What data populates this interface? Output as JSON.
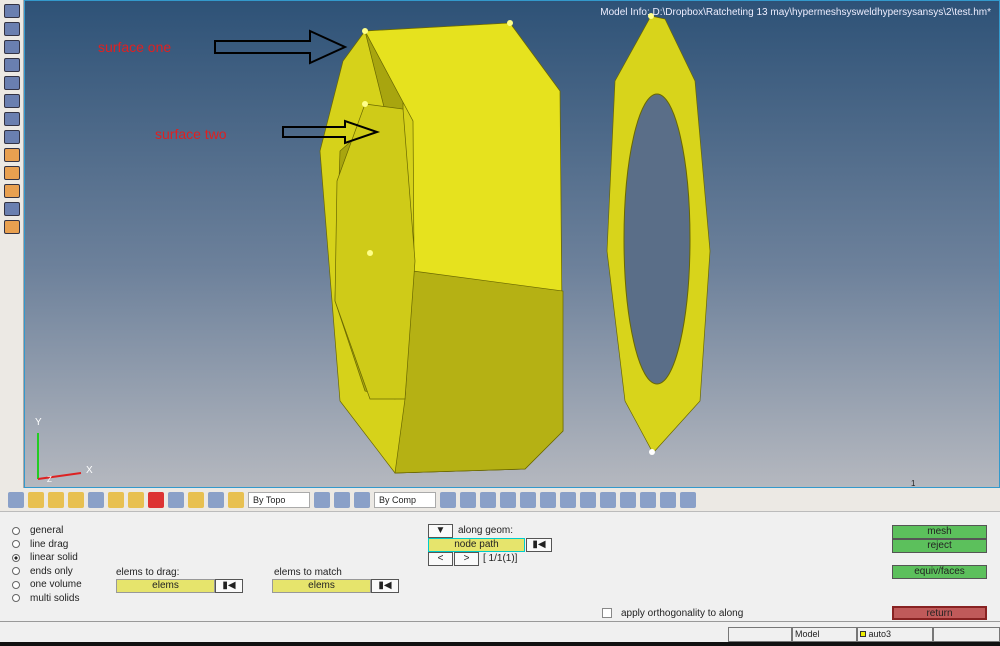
{
  "viewport": {
    "model_info": "Model Info: D:\\Dropbox\\Ratcheting 13 may\\hypermeshsysweldhypersysansys\\2\\test.hm*",
    "label_one": "surface one",
    "label_two": "surface two",
    "axis_y": "Y",
    "axis_x": "X",
    "axis_z": "Z",
    "page_num": "1"
  },
  "toolbar": {
    "by_topo": "By Topo",
    "by_comp": "By Comp"
  },
  "panel": {
    "radios": [
      {
        "label": "general",
        "checked": false
      },
      {
        "label": "line drag",
        "checked": false
      },
      {
        "label": "linear solid",
        "checked": true
      },
      {
        "label": "ends only",
        "checked": false
      },
      {
        "label": "one volume",
        "checked": false
      },
      {
        "label": "multi solids",
        "checked": false
      }
    ],
    "elems_to_drag_label": "elems to drag:",
    "elems_to_drag_btn": "elems",
    "elems_to_match_label": "elems to match",
    "elems_to_match_btn": "elems",
    "along_geom": "along geom:",
    "node_path": "node path",
    "prev": "<",
    "next": ">",
    "counter": "[ 1/1(1)]",
    "apply_ortho": "apply orthogonality to along",
    "mesh": "mesh",
    "reject": "reject",
    "equiv": "equiv/faces",
    "return": "return"
  },
  "status": {
    "model": "Model",
    "comp": "auto3"
  }
}
